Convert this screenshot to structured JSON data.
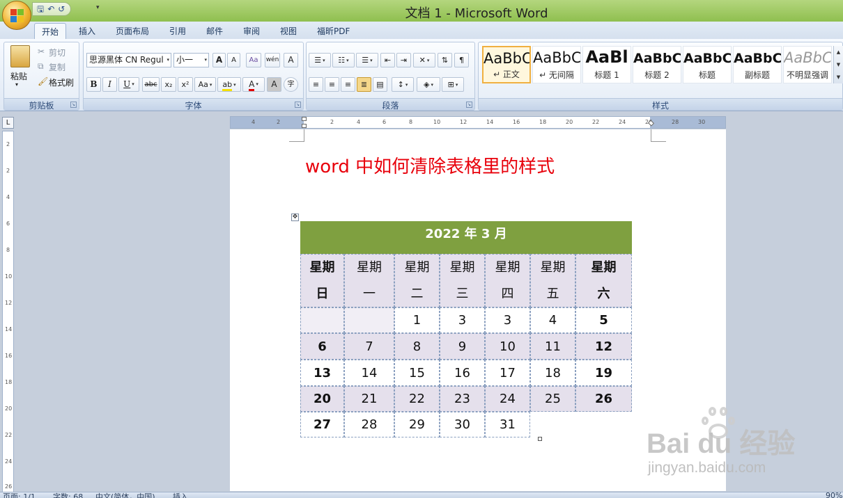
{
  "window": {
    "title": "文档 1 - Microsoft Word"
  },
  "qat": {
    "save": "🖫",
    "undo": "↶",
    "redo": "↺",
    "more": "▾"
  },
  "tabs": [
    "开始",
    "插入",
    "页面布局",
    "引用",
    "邮件",
    "审阅",
    "视图",
    "福昕PDF"
  ],
  "active_tab": "开始",
  "ribbon": {
    "clipboard": {
      "paste": "粘贴",
      "cut": "剪切",
      "copy": "复制",
      "format_painter": "格式刷",
      "label": "剪贴板"
    },
    "font": {
      "font_name": "思源黑体 CN Regul",
      "font_size": "小一",
      "grow": "A",
      "shrink": "A",
      "clear": "Aa",
      "wen": "wén",
      "char_border": "A",
      "bold": "B",
      "italic": "I",
      "underline": "U",
      "strike": "abc",
      "subscript": "x₂",
      "superscript": "x²",
      "case": "Aa",
      "highlight": "ab",
      "font_color": "A",
      "char_shading": "A",
      "enclose": "字",
      "label": "字体"
    },
    "paragraph": {
      "label": "段落"
    },
    "styles": {
      "label": "样式",
      "items": [
        {
          "sample": "AaBbC",
          "name": "↵ 正文",
          "selected": true
        },
        {
          "sample": "AaBbC",
          "name": "↵ 无间隔",
          "selected": false
        },
        {
          "sample": "AaBl",
          "name": "标题 1",
          "selected": false
        },
        {
          "sample": "AaBbC",
          "name": "标题 2",
          "selected": false
        },
        {
          "sample": "AaBbC",
          "name": "标题",
          "selected": false
        },
        {
          "sample": "AaBbC",
          "name": "副标题",
          "selected": false
        },
        {
          "sample": "AaBbC",
          "name": "不明显强调",
          "selected": false
        }
      ]
    }
  },
  "ruler": {
    "h_ticks": [
      "4",
      "2",
      "2",
      "4",
      "6",
      "8",
      "10",
      "12",
      "14",
      "16",
      "18",
      "20",
      "22",
      "24",
      "26",
      "28",
      "30"
    ],
    "v_ticks": [
      "2",
      "2",
      "4",
      "6",
      "8",
      "10",
      "12",
      "14",
      "16",
      "18",
      "20",
      "22",
      "24",
      "26"
    ]
  },
  "document": {
    "heading": "word 中如何清除表格里的样式",
    "calendar": {
      "title": "2022 年 3 月",
      "weekdays": [
        [
          "星期",
          "日"
        ],
        [
          "星期",
          "一"
        ],
        [
          "星期",
          "二"
        ],
        [
          "星期",
          "三"
        ],
        [
          "星期",
          "四"
        ],
        [
          "星期",
          "五"
        ],
        [
          "星期",
          "六"
        ]
      ],
      "rows": [
        [
          "",
          "",
          "1",
          "3",
          "3",
          "4",
          "5"
        ],
        [
          "6",
          "7",
          "8",
          "9",
          "10",
          "11",
          "12"
        ],
        [
          "13",
          "14",
          "15",
          "16",
          "17",
          "18",
          "19"
        ],
        [
          "20",
          "21",
          "22",
          "23",
          "24",
          "25",
          "26"
        ],
        [
          "27",
          "28",
          "29",
          "30",
          "31",
          "",
          ""
        ]
      ]
    }
  },
  "watermark": {
    "brand": "Bai du 经验",
    "url": "jingyan.baidu.com"
  },
  "statusbar": {
    "page": "页面: 1/1",
    "words": "字数: 68",
    "lang": "中文(简体，中国)",
    "mode": "插入",
    "zoom": "90%"
  },
  "colors": {
    "title_bar": "#a3cb68",
    "calendar_header": "#7fa040",
    "heading_text": "#e8000b",
    "band": "#e5e0ec"
  }
}
